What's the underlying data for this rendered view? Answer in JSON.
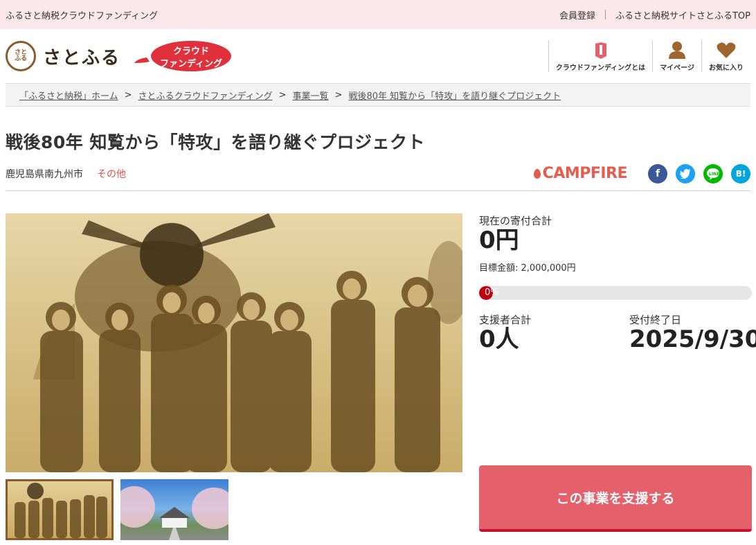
{
  "topbar": {
    "site_name": "ふるさと納税クラウドファンディング",
    "member_register": "会員登録",
    "top_link": "ふるさと納税サイトさとふるTOP"
  },
  "header": {
    "seal_text": "さとふる",
    "brand_name": "さとふる",
    "badge_line1": "クラウド",
    "badge_line2": "ファンディング",
    "nav": [
      {
        "label": "クラウドファンディングとは",
        "icon": "bookmark-icon"
      },
      {
        "label": "マイページ",
        "icon": "user-icon"
      },
      {
        "label": "お気に入り",
        "icon": "heart-icon"
      }
    ]
  },
  "breadcrumb": [
    "「ふるさと納税」ホーム",
    "さとふるクラウドファンディング",
    "事業一覧",
    "戦後80年 知覧から「特攻」を語り継ぐプロジェクト"
  ],
  "project": {
    "title": "戦後80年 知覧から「特攻」を語り継ぐプロジェクト",
    "municipality": "鹿児島県南九州市",
    "category": "その他",
    "platform": "CAMPFIRE"
  },
  "share": [
    {
      "name": "facebook-icon",
      "glyph": "f",
      "color": "#3b5998"
    },
    {
      "name": "twitter-icon",
      "glyph": "t",
      "color": "#1da1f2"
    },
    {
      "name": "line-icon",
      "glyph": "L",
      "color": "#00b900"
    },
    {
      "name": "hatena-icon",
      "glyph": "B!",
      "color": "#00a4de"
    }
  ],
  "funding": {
    "total_label": "現在の寄付合計",
    "total_value": "0円",
    "goal_label": "目標金額: 2,000,000円",
    "progress_pct": 0,
    "progress_text": "0%",
    "supporters_label": "支援者合計",
    "supporters_value": "0人",
    "deadline_label": "受付終了日",
    "deadline_value": "2025/9/30",
    "button_label": "この事業を支援する"
  },
  "colors": {
    "accent": "#e4606a",
    "brand_brown": "#8a5a2b",
    "progress": "#c0000f"
  }
}
